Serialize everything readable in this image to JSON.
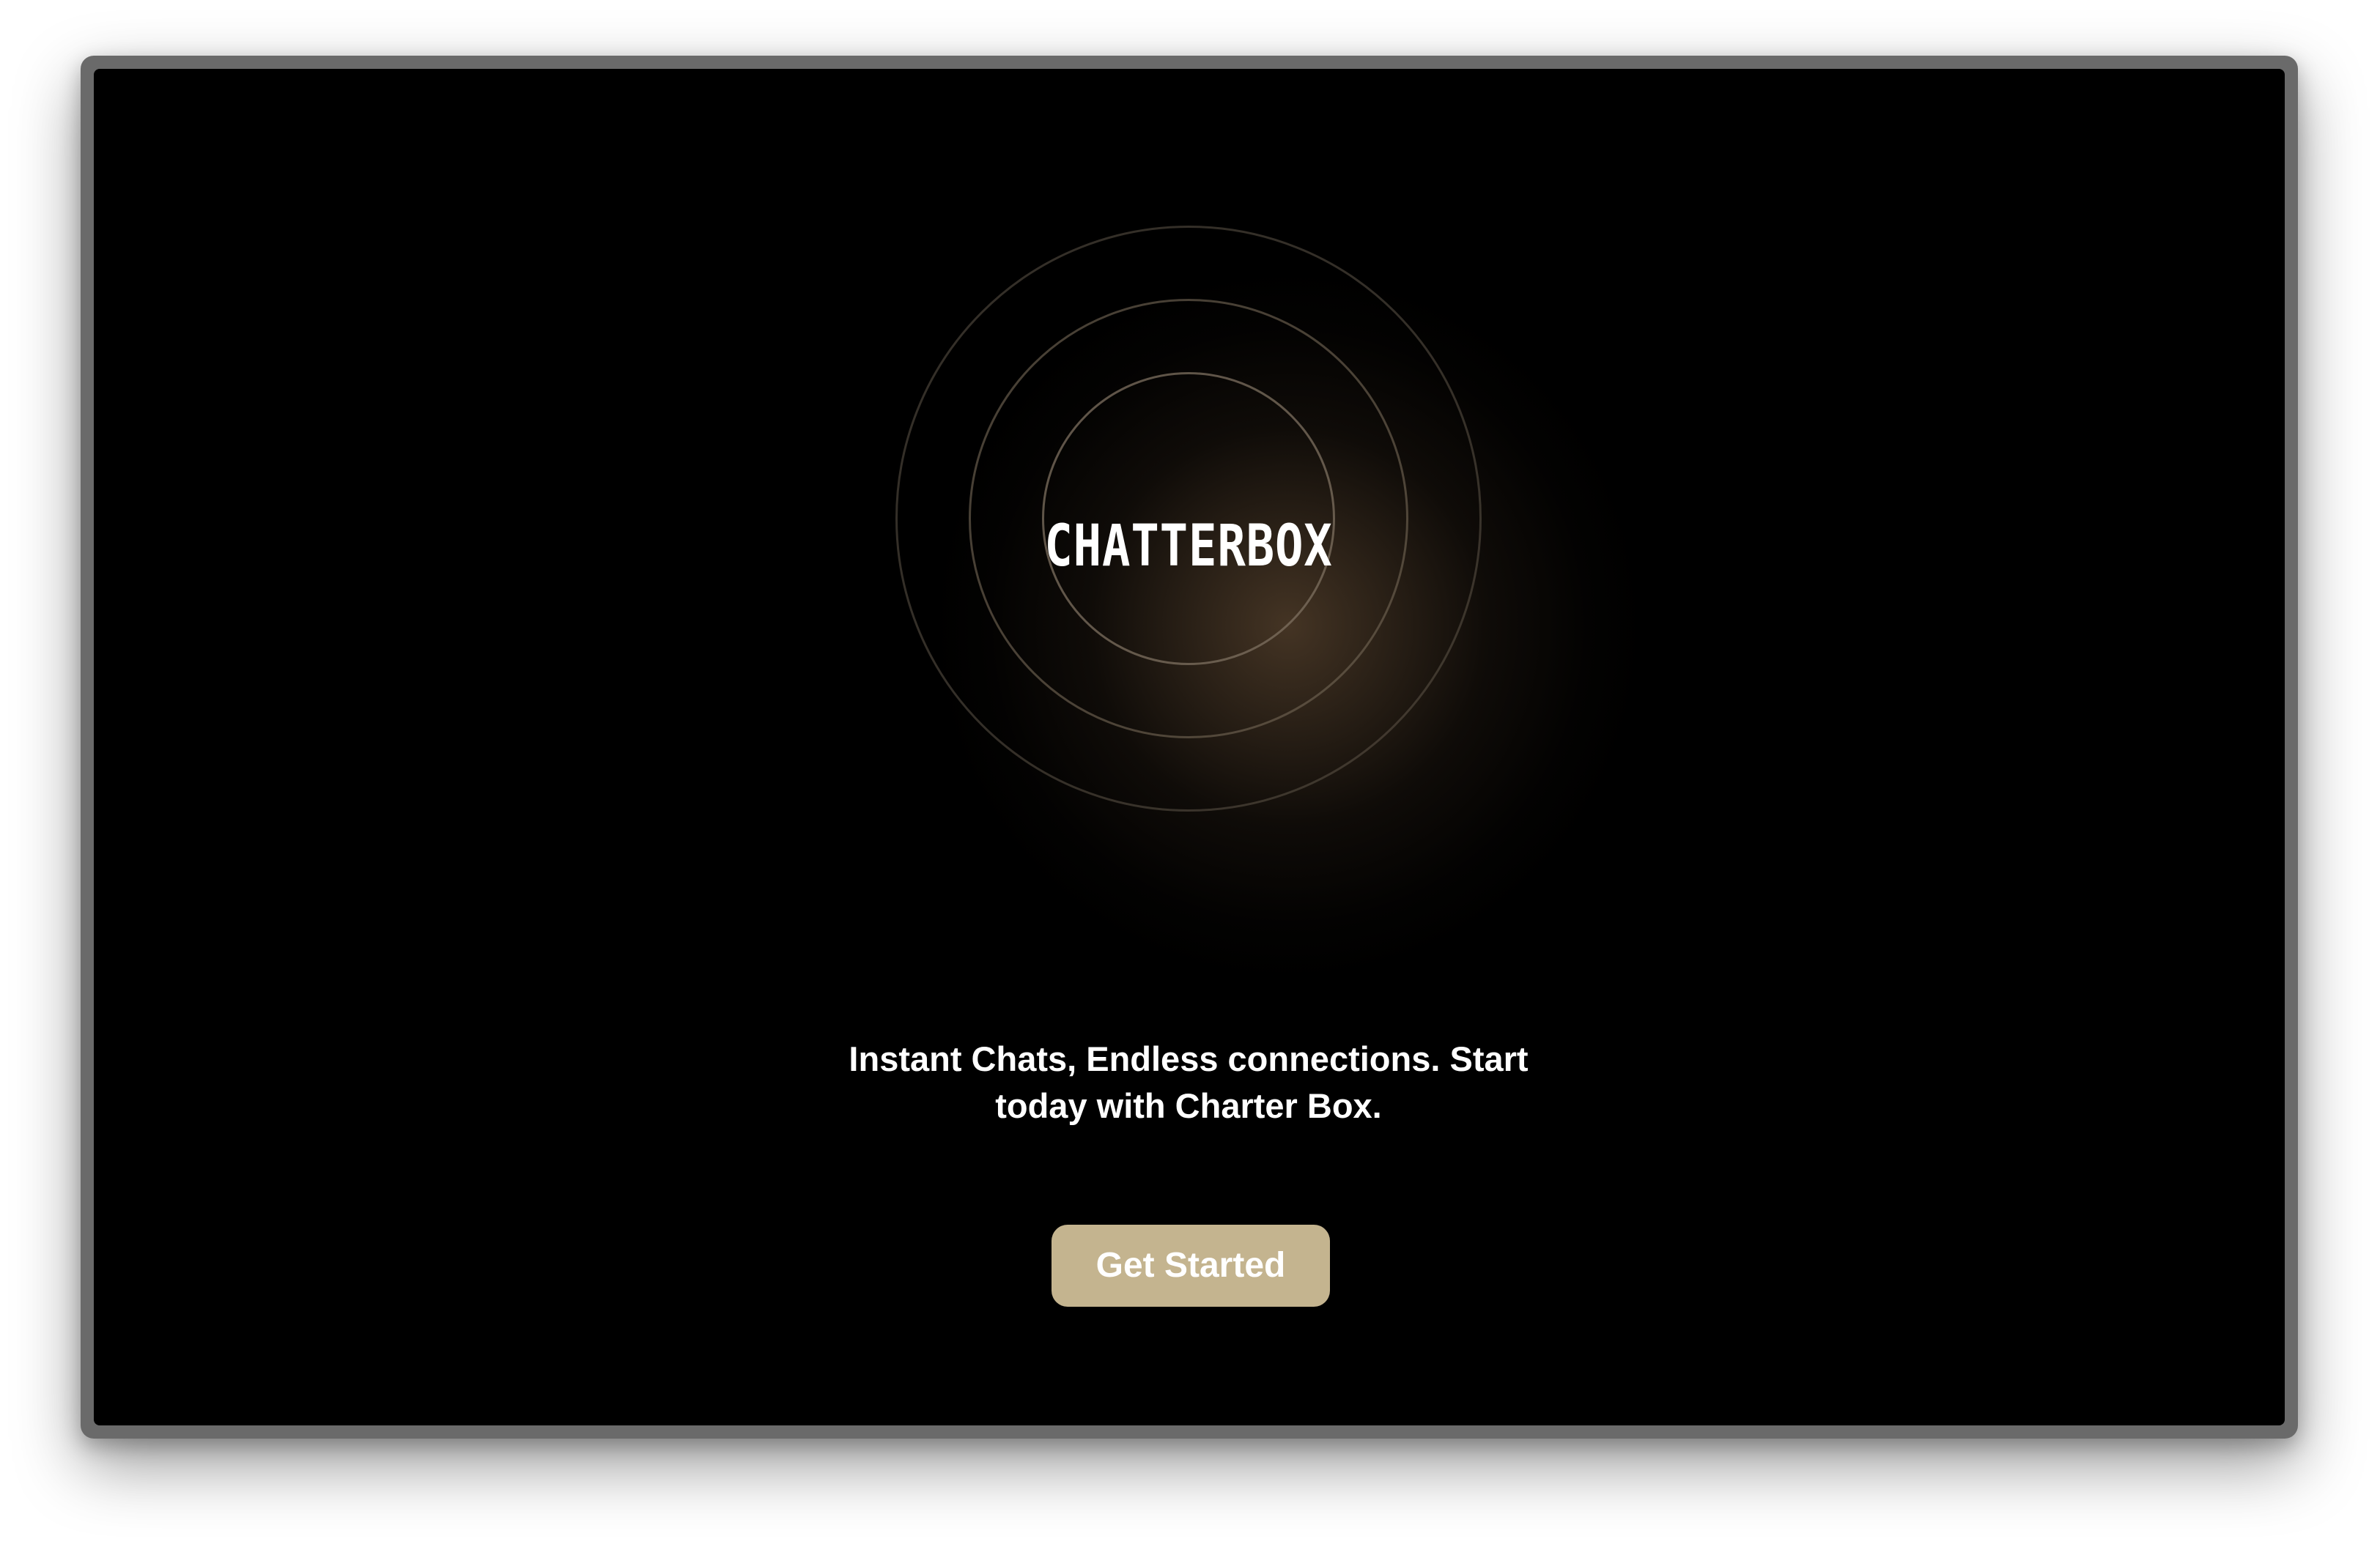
{
  "app": {
    "logo_text": "CHATTERBOX",
    "tagline": "Instant Chats, Endless connections. Start today with Charter Box.",
    "cta_label": "Get Started"
  },
  "colors": {
    "background": "#000000",
    "accent": "#c4b48f",
    "text": "#ffffff",
    "glow": "#3a2c1e",
    "frame": "#6a6a6a"
  }
}
